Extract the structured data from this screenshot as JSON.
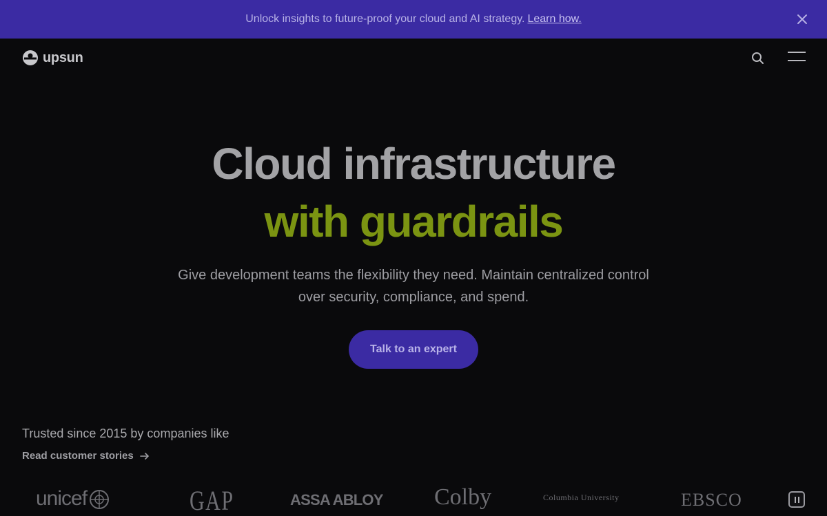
{
  "banner": {
    "message": "Unlock insights to future-proof your cloud and AI strategy.",
    "link": "Learn how.",
    "close_icon": "close-icon"
  },
  "header": {
    "logo_text": "upsun",
    "search_icon": "search-icon",
    "menu_icon": "hamburger-menu-icon"
  },
  "hero": {
    "title_line1": "Cloud infrastructure",
    "title_line2": "with guardrails",
    "subtitle": "Give development teams the flexibility they need. Maintain centralized control over security, compliance, and spend.",
    "cta_label": "Talk to an expert"
  },
  "trusted": {
    "text": "Trusted since 2015 by companies like",
    "link": "Read customer stories"
  },
  "logos": {
    "items": [
      "unicef",
      "GAP",
      "ASSA ABLOY",
      "Colby",
      "Columbia University",
      "EBSCO"
    ],
    "pause_icon": "pause-icon"
  },
  "colors": {
    "banner_bg": "#3b2ba3",
    "page_bg": "#0a0a0c",
    "accent_green": "#7b9412",
    "cta_bg": "#3b2ba3"
  }
}
